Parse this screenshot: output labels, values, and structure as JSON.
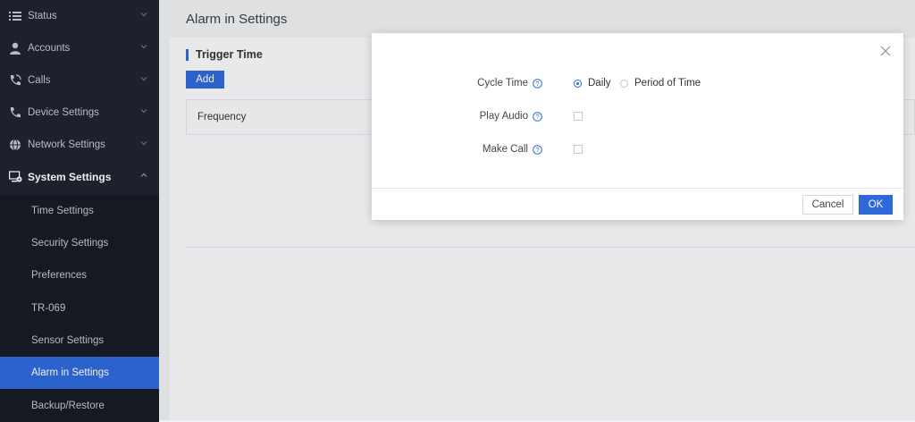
{
  "sidebar": {
    "items": [
      {
        "label": "Status",
        "icon": "list-icon"
      },
      {
        "label": "Accounts",
        "icon": "user-icon"
      },
      {
        "label": "Calls",
        "icon": "phone-calls-icon"
      },
      {
        "label": "Device Settings",
        "icon": "phone-icon"
      },
      {
        "label": "Network Settings",
        "icon": "globe-icon"
      },
      {
        "label": "System Settings",
        "icon": "monitor-gear-icon"
      }
    ],
    "sub_items": [
      {
        "label": "Time Settings"
      },
      {
        "label": "Security Settings"
      },
      {
        "label": "Preferences"
      },
      {
        "label": "TR-069"
      },
      {
        "label": "Sensor Settings"
      },
      {
        "label": "Alarm in Settings"
      },
      {
        "label": "Backup/Restore"
      }
    ]
  },
  "main": {
    "title": "Alarm in Settings",
    "section_title": "Trigger Time",
    "add_label": "Add",
    "table_header_frequency": "Frequency"
  },
  "dialog": {
    "cycle_time_label": "Cycle Time",
    "options": [
      "Daily",
      "Period of Time"
    ],
    "selected_option": "Daily",
    "play_audio_label": "Play Audio",
    "play_audio_checked": false,
    "make_call_label": "Make Call",
    "make_call_checked": false,
    "cancel_label": "Cancel",
    "ok_label": "OK"
  },
  "colors": {
    "accent": "#2f69d9",
    "sidebar_bg": "#1f2430",
    "sidebar_active_bg": "#2f69d9"
  }
}
